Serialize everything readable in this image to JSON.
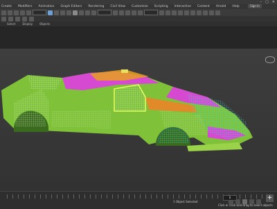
{
  "menu": [
    "Create",
    "Modifiers",
    "Animation",
    "Graph Editors",
    "Rendering",
    "Civil View",
    "Customize",
    "Scripting",
    "Interactive",
    "Content",
    "Arnold",
    "Help"
  ],
  "signin_label": "Sign In",
  "window_controls": [
    "–",
    "▢",
    "✕"
  ],
  "tabs": [
    "Select",
    "Display",
    "Objects"
  ],
  "status": {
    "line1": "1 Object Selected",
    "line2": "Click or click-and-drag to select objects",
    "frame": "0",
    "zoom": "+"
  },
  "colors": {
    "model_green": "#7fc23a",
    "model_magenta": "#d64ad2",
    "model_wire_cyan": "#39d6c8",
    "model_orange": "#e08a2a"
  }
}
